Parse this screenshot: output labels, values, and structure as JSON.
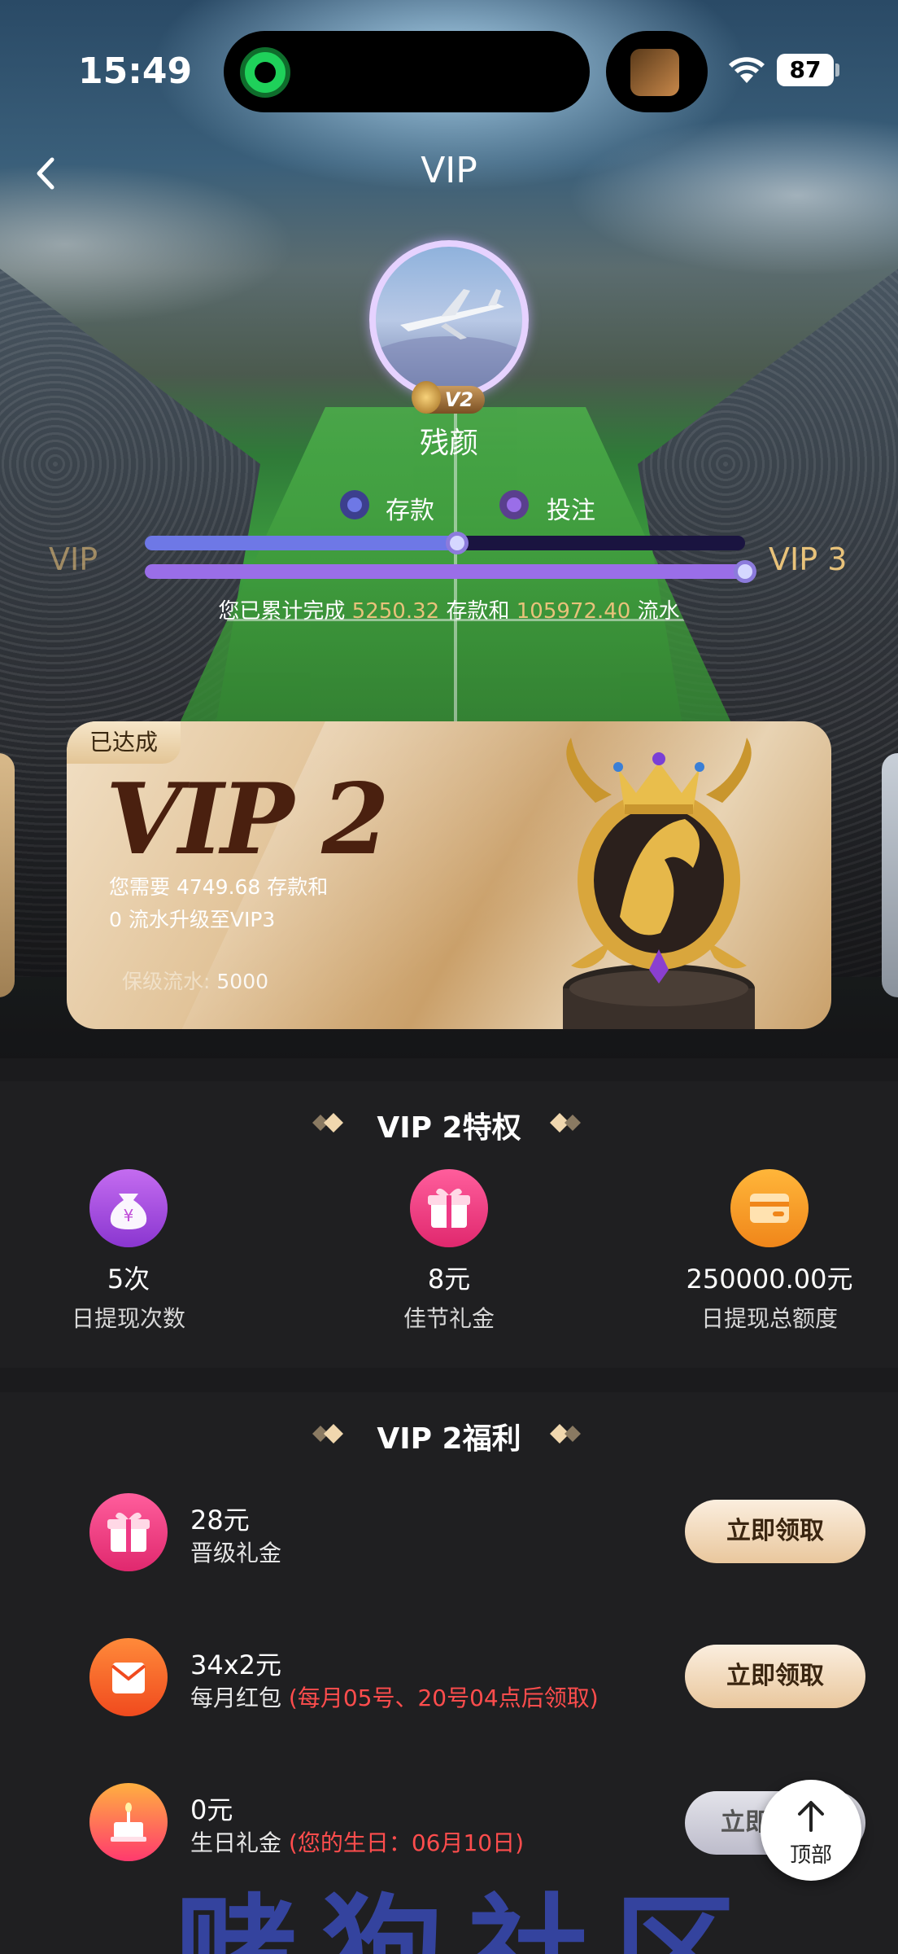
{
  "status_bar": {
    "time": "15:49",
    "battery": "87"
  },
  "nav": {
    "title": "VIP"
  },
  "profile": {
    "vip_badge": "V2",
    "username": "残颜"
  },
  "legend": {
    "deposit": "存款",
    "bet": "投注"
  },
  "progress": {
    "left_level": "VIP",
    "right_level": "VIP 3",
    "deposit_fraction": 0.52,
    "bet_fraction": 1.0,
    "text_prefix": "您已累计完成",
    "deposit_amount": "5250.32",
    "text_mid": "存款和",
    "turnover_amount": "105972.40",
    "text_suffix": "流水"
  },
  "vip_card": {
    "achieved": "已达成",
    "level": "VIP 2",
    "need_line1": "您需要 4749.68 存款和",
    "need_line2": "0 流水升级至VIP3",
    "keep_label": "保级流水:",
    "keep_value": "5000"
  },
  "privileges": {
    "title": "VIP 2特权",
    "items": [
      {
        "value": "5次",
        "label": "日提现次数",
        "icon": "money-bag-icon",
        "color": "#a54de0"
      },
      {
        "value": "8元",
        "label": "佳节礼金",
        "icon": "gift-icon",
        "color": "#ef3a86"
      },
      {
        "value": "250000.00元",
        "label": "日提现总额度",
        "icon": "wallet-icon",
        "color": "#f29a1e"
      }
    ]
  },
  "benefits": {
    "title": "VIP 2福利",
    "items": [
      {
        "amount": "28元",
        "label": "晋级礼金",
        "note": "",
        "button": "立即领取",
        "icon": "gift-icon"
      },
      {
        "amount": "34x2元",
        "label": "每月红包",
        "note": "(每月05号、20号04点后领取)",
        "button": "立即领取",
        "icon": "red-envelope-icon"
      },
      {
        "amount": "0元",
        "label": "生日礼金",
        "note": "(您的生日：06月10日)",
        "button": "立即",
        "icon": "cake-icon"
      }
    ]
  },
  "back_to_top": {
    "label": "顶部"
  },
  "watermark": {
    "text": "赌狗社区"
  },
  "colors": {
    "gold": "#e8c27a",
    "deposit_bar": "#6e78e6",
    "bet_bar": "#9a6ee8",
    "red_note": "#ff4d4d"
  }
}
